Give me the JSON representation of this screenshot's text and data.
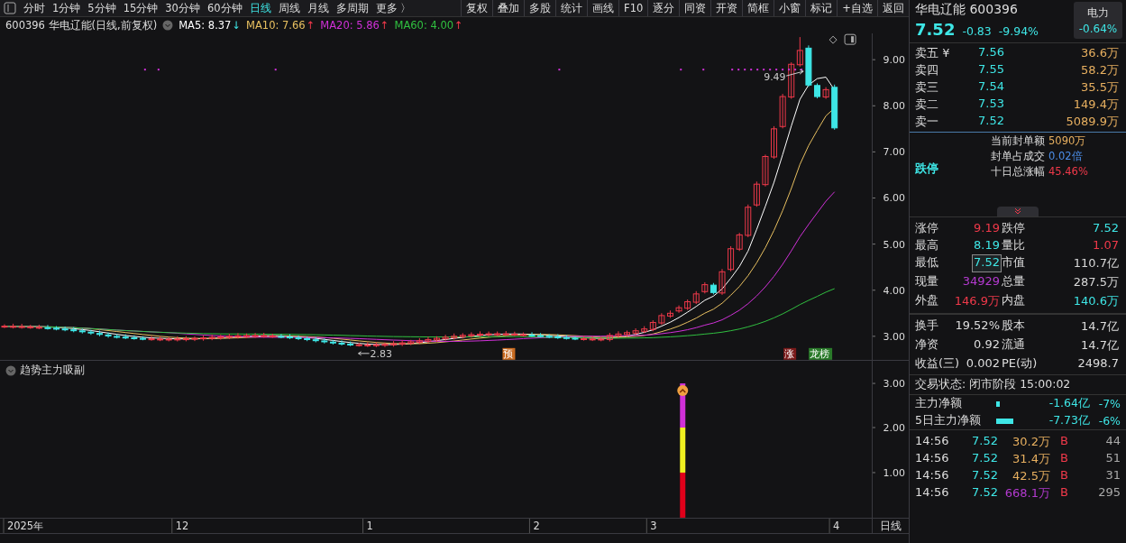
{
  "toolbar": {
    "periods": [
      {
        "label": "分时",
        "selected": false
      },
      {
        "label": "1分钟",
        "selected": false
      },
      {
        "label": "5分钟",
        "selected": false
      },
      {
        "label": "15分钟",
        "selected": false
      },
      {
        "label": "30分钟",
        "selected": false
      },
      {
        "label": "60分钟",
        "selected": false
      },
      {
        "label": "日线",
        "selected": true
      },
      {
        "label": "周线",
        "selected": false
      },
      {
        "label": "月线",
        "selected": false
      },
      {
        "label": "多周期",
        "selected": false
      },
      {
        "label": "更多 〉",
        "selected": false
      }
    ],
    "buttons": [
      "复权",
      "叠加",
      "多股",
      "统计",
      "画线",
      "F10",
      "逐分",
      "同资",
      "开资",
      "简框",
      "小窗",
      "标记",
      "+自选",
      "返回"
    ]
  },
  "chart": {
    "legend": {
      "title": "600396 华电辽能(日线,前复权)",
      "ma": [
        {
          "label": "MA5: 8.37",
          "arrow": "↓",
          "color": "#ffffff"
        },
        {
          "label": "MA10: 7.66",
          "arrow": "↑",
          "color": "#e8c060"
        },
        {
          "label": "MA20: 5.86",
          "arrow": "↑",
          "color": "#d030d8"
        },
        {
          "label": "MA60: 4.00",
          "arrow": "↑",
          "color": "#30c040"
        }
      ]
    },
    "price_axis": [
      "9.00",
      "8.00",
      "7.00",
      "6.00",
      "5.00",
      "4.00",
      "3.00"
    ],
    "high_label": "9.49",
    "low_label": "2.83",
    "markers": [
      {
        "text": "预",
        "color": "#c86a20"
      },
      {
        "text": "涨",
        "color": "#7a1a1a"
      },
      {
        "text": "龙榜",
        "color": "#2a7a2a"
      }
    ]
  },
  "indicator": {
    "title": "趋势主力吸副",
    "axis": [
      "3.00",
      "2.00",
      "1.00"
    ]
  },
  "date_axis": {
    "labels": [
      "2025年",
      "12",
      "1",
      "2",
      "3",
      "4"
    ],
    "period": "日线"
  },
  "quote": {
    "name": "华电辽能",
    "code": "600396",
    "sector": "电力",
    "sector_change": "-0.64%",
    "price": "7.52",
    "change": "-0.83",
    "change_pct": "-9.94%",
    "asks": [
      {
        "label": "卖五",
        "price": "7.56",
        "volume": "36.6万"
      },
      {
        "label": "卖四",
        "price": "7.55",
        "volume": "58.2万"
      },
      {
        "label": "卖三",
        "price": "7.54",
        "volume": "35.5万"
      },
      {
        "label": "卖二",
        "price": "7.53",
        "volume": "149.4万"
      },
      {
        "label": "卖一",
        "price": "7.52",
        "volume": "5089.9万"
      }
    ],
    "currency": "¥",
    "limit_state": "跌停",
    "seal": [
      {
        "label": "当前封单额",
        "value": "5090万",
        "color": "#e8b060"
      },
      {
        "label": "封单占成交",
        "value": "0.02倍",
        "color": "#4c8ee8"
      },
      {
        "label": "十日总涨幅",
        "value": "45.46%",
        "color": "#f0394a"
      }
    ],
    "stats": [
      {
        "label": "涨停",
        "value": "9.19",
        "color": "#f0394a",
        "highlighted": false
      },
      {
        "label": "跌停",
        "value": "7.52",
        "color": "#3ee6e6",
        "highlighted": false
      },
      {
        "label": "最高",
        "value": "8.19",
        "color": "#3ee6e6",
        "highlighted": false
      },
      {
        "label": "量比",
        "value": "1.07",
        "color": "#f0394a",
        "highlighted": false
      },
      {
        "label": "最低",
        "value": "7.52",
        "color": "#3ee6e6",
        "highlighted": true
      },
      {
        "label": "市值",
        "value": "110.7亿",
        "color": "#d8d8d8",
        "highlighted": false
      },
      {
        "label": "现量",
        "value": "34929",
        "color": "#b43ad0",
        "highlighted": false
      },
      {
        "label": "总量",
        "value": "287.5万",
        "color": "#d8d8d8",
        "highlighted": false
      },
      {
        "label": "外盘",
        "value": "146.9万",
        "color": "#f0394a",
        "highlighted": false
      },
      {
        "label": "内盘",
        "value": "140.6万",
        "color": "#3ee6e6",
        "highlighted": false
      }
    ],
    "stats2": [
      {
        "label": "换手",
        "value": "19.52%"
      },
      {
        "label": "股本",
        "value": "14.7亿"
      },
      {
        "label": "净资",
        "value": "0.92"
      },
      {
        "label": "流通",
        "value": "14.7亿"
      },
      {
        "label": "收益(三)",
        "value": "0.002"
      },
      {
        "label": "PE(动)",
        "value": "2498.7"
      }
    ],
    "status": "交易状态: 闭市阶段 15:00:02",
    "flows": [
      {
        "label": "主力净额",
        "amount": "-1.64亿",
        "pct": "-7%"
      },
      {
        "label": "5日主力净额",
        "amount": "-7.73亿",
        "pct": "-6%"
      }
    ],
    "trades": [
      {
        "time": "14:56",
        "price": "7.52",
        "volume": "30.2万",
        "side": "B",
        "count": "44",
        "large": false
      },
      {
        "time": "14:56",
        "price": "7.52",
        "volume": "31.4万",
        "side": "B",
        "count": "51",
        "large": false
      },
      {
        "time": "14:56",
        "price": "7.52",
        "volume": "42.5万",
        "side": "B",
        "count": "31",
        "large": false
      },
      {
        "time": "14:56",
        "price": "7.52",
        "volume": "668.1万",
        "side": "B",
        "count": "295",
        "large": true
      }
    ]
  }
}
